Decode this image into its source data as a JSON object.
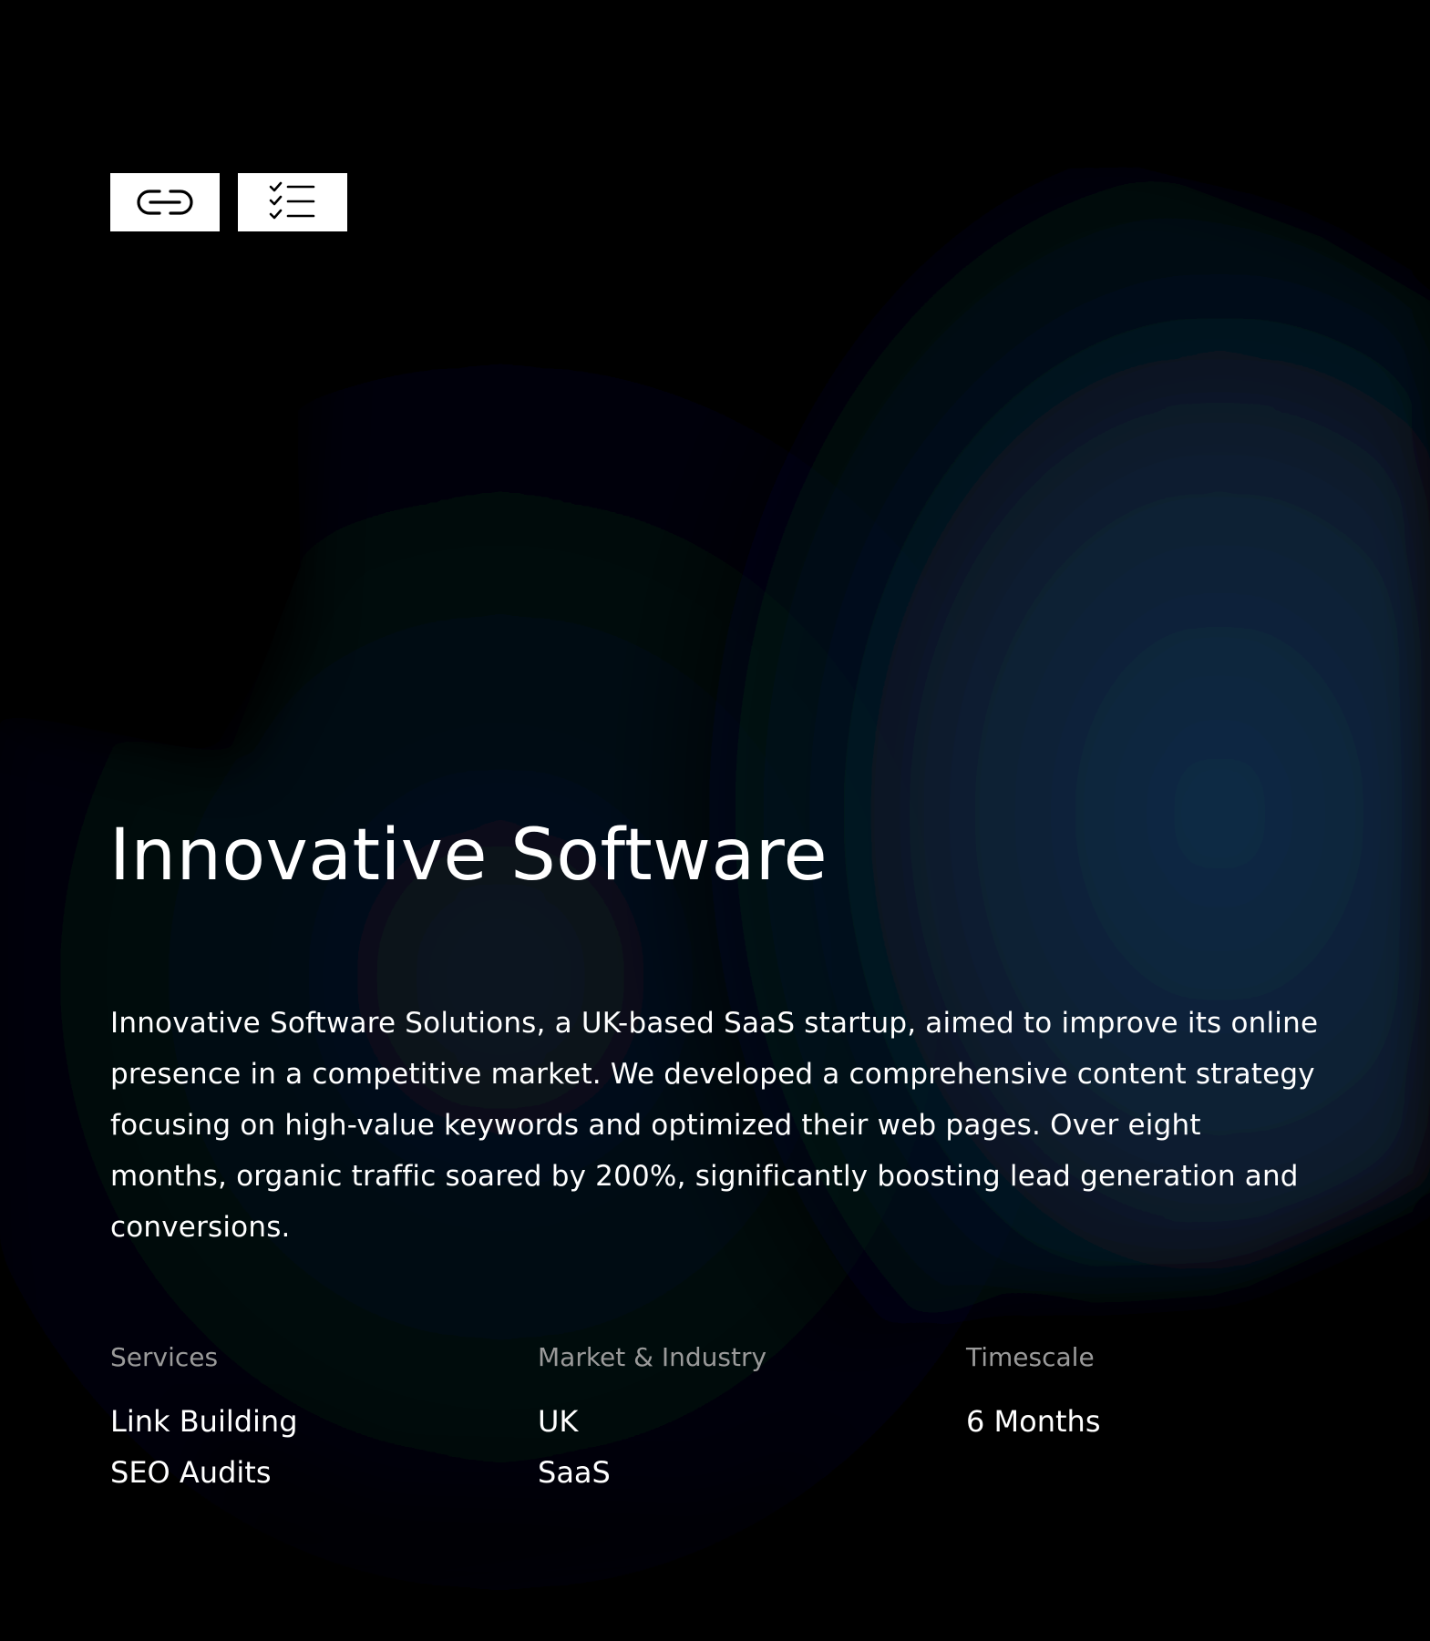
{
  "toolbar": {
    "icons": [
      {
        "name": "link-icon",
        "interactable": true
      },
      {
        "name": "checklist-icon",
        "interactable": true
      }
    ]
  },
  "case_study": {
    "title": "Innovative Software",
    "description": "Innovative Software Solutions, a UK-based SaaS startup, aimed to improve its online presence in a competitive market. We developed a comprehensive content strategy focusing on high-value keywords and optimized their web pages. Over eight months, organic traffic soared by 200%, significantly boosting lead generation and conversions."
  },
  "meta": {
    "services": {
      "heading": "Services",
      "items": [
        "Link Building",
        "SEO Audits"
      ]
    },
    "market": {
      "heading": "Market & Industry",
      "items": [
        "UK",
        "SaaS"
      ]
    },
    "timescale": {
      "heading": "Timescale",
      "items": [
        "6 Months"
      ]
    }
  },
  "colors": {
    "background": "#000000",
    "glow": "#0c2a44",
    "text": "#ffffff",
    "muted": "#9a9a9a"
  }
}
